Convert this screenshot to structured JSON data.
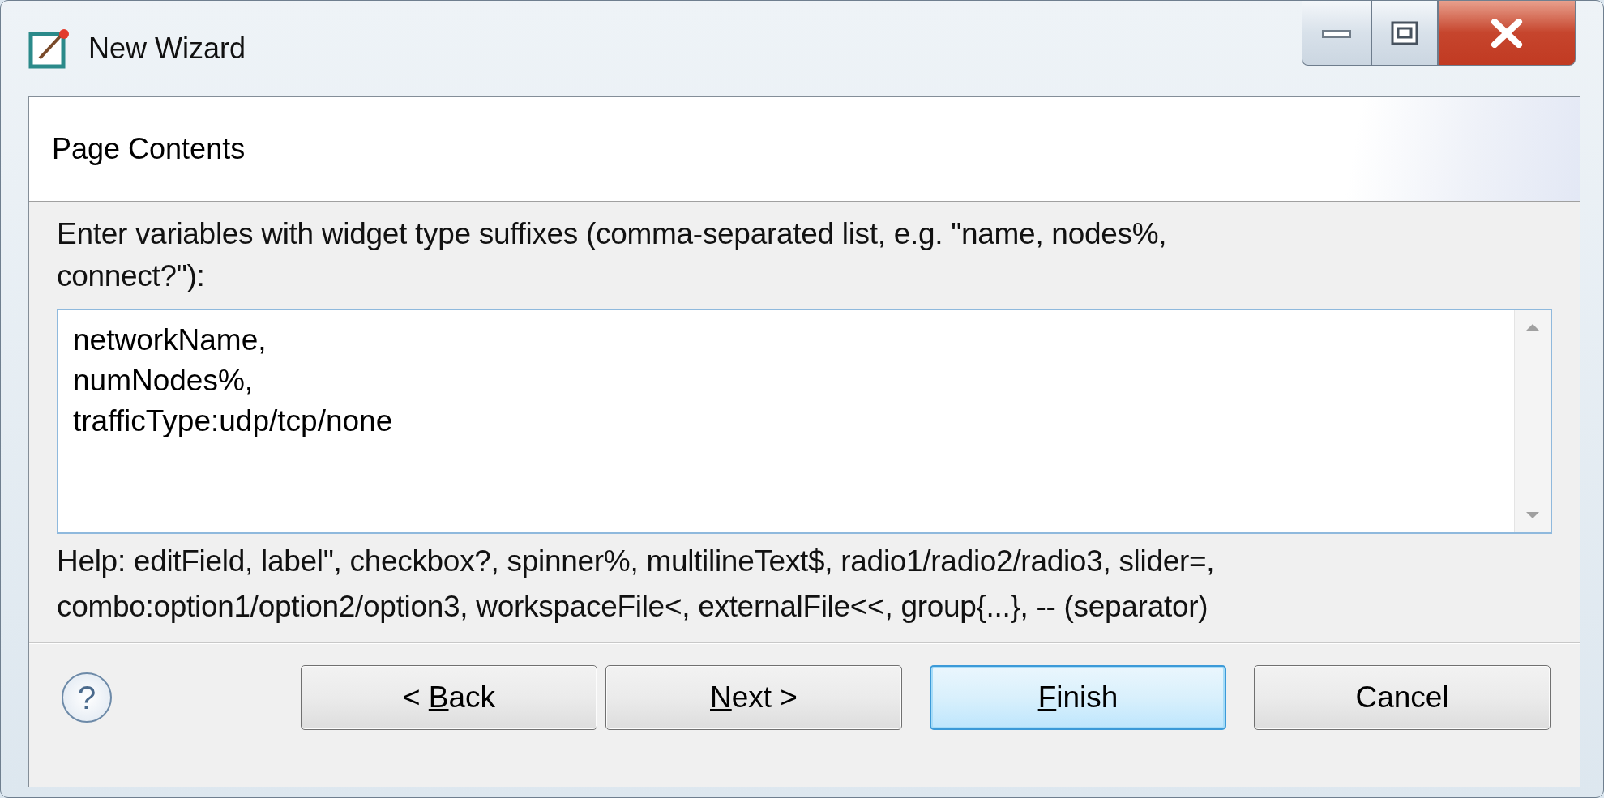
{
  "window": {
    "title": "New Wizard"
  },
  "header": {
    "title": "Page Contents"
  },
  "description_lines": [
    "Enter variables with widget type suffixes (comma-separated list, e.g. \"name, nodes%,",
    "connect?\"):"
  ],
  "variables_field": {
    "lines": [
      "networkName,",
      "numNodes%,",
      "trafficType:udp/tcp/none"
    ]
  },
  "help_lines": [
    "Help: editField, label\", checkbox?, spinner%, multilineText$, radio1/radio2/radio3, slider=,",
    "combo:option1/option2/option3, workspaceFile<, externalFile<<, group{...}, -- (separator)"
  ],
  "help_button": "?",
  "buttons": [
    {
      "prefix": "< ",
      "mnemonic": "B",
      "suffix": "ack",
      "default": false
    },
    {
      "mnemonic": "N",
      "suffix": "ext >",
      "default": false
    },
    {
      "mnemonic": "F",
      "suffix": "inish",
      "default": true
    },
    {
      "prefix": "Cancel",
      "default": false
    }
  ]
}
